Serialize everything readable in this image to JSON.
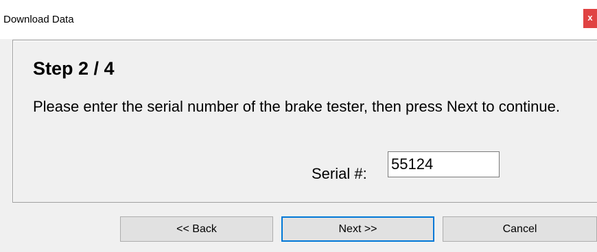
{
  "window": {
    "title": "Download Data",
    "close_glyph": "x"
  },
  "step": {
    "title": "Step 2 / 4",
    "instructions": "Please enter the serial number of the brake tester, then press Next to continue."
  },
  "serial": {
    "label": "Serial #:",
    "value": "55124"
  },
  "buttons": {
    "back": "<< Back",
    "next": "Next >>",
    "cancel": "Cancel"
  }
}
